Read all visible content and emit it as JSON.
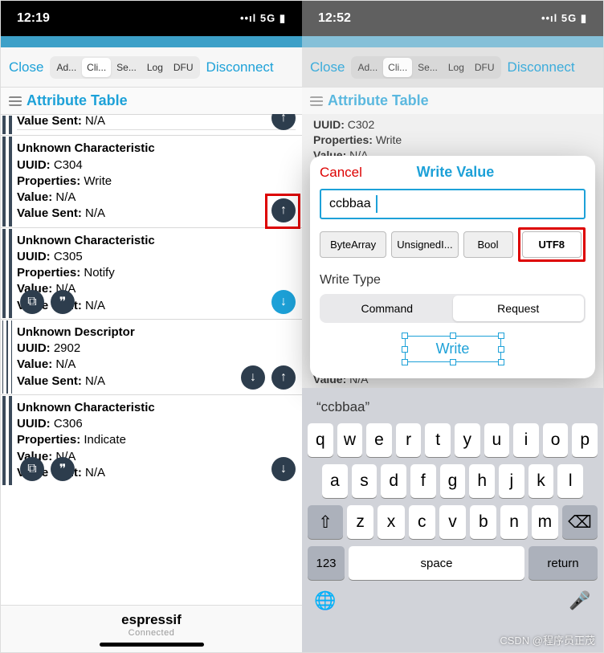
{
  "left": {
    "status": {
      "time": "12:19",
      "signal": "5G"
    },
    "header": {
      "close": "Close",
      "tabs": [
        "Ad...",
        "Cli...",
        "Se...",
        "Log",
        "DFU"
      ],
      "active": 1,
      "disconnect": "Disconnect"
    },
    "title": "Attribute Table",
    "peekRow": {
      "valueSentLbl": "Value Sent:",
      "valueSent": "N/A"
    },
    "chars": [
      {
        "name": "Unknown Characteristic",
        "uuidLbl": "UUID:",
        "uuid": "C304",
        "propsLbl": "Properties:",
        "props": "Write",
        "valueLbl": "Value:",
        "value": "N/A",
        "valueSentLbl": "Value Sent:",
        "valueSent": "N/A",
        "up": true,
        "highlight": true
      },
      {
        "name": "Unknown Characteristic",
        "uuidLbl": "UUID:",
        "uuid": "C305",
        "propsLbl": "Properties:",
        "props": "Notify",
        "valueLbl": "Value:",
        "value": "N/A",
        "valueSentLbl": "Value Sent:",
        "valueSent": "N/A",
        "down": true,
        "copy": true
      },
      {
        "name": "Unknown Descriptor",
        "uuidLbl": "UUID:",
        "uuid": "2902",
        "valueLbl": "Value:",
        "value": "N/A",
        "valueSentLbl": "Value Sent:",
        "valueSent": "N/A",
        "updown": true
      },
      {
        "name": "Unknown Characteristic",
        "uuidLbl": "UUID:",
        "uuid": "C306",
        "propsLbl": "Properties:",
        "props": "Indicate",
        "valueLbl": "Value:",
        "value": "N/A",
        "valueSentLbl": "Value Sent:",
        "valueSent": "N/A",
        "down": true,
        "copy": true
      }
    ],
    "footer": {
      "name": "espressif",
      "status": "Connected"
    }
  },
  "right": {
    "status": {
      "time": "12:52",
      "signal": "5G"
    },
    "header": {
      "close": "Close",
      "tabs": [
        "Ad...",
        "Cli...",
        "Se...",
        "Log",
        "DFU"
      ],
      "active": 1,
      "disconnect": "Disconnect"
    },
    "title": "Attribute Table",
    "bg": {
      "uuidLbl": "UUID:",
      "uuid": "C302",
      "propsLbl": "Properties:",
      "props": "Write",
      "valueLbl": "Value:",
      "value": "N/A",
      "value2Lbl": "Value:",
      "value2": "N/A"
    },
    "modal": {
      "cancel": "Cancel",
      "title": "Write Value",
      "input": "ccbbaa",
      "formats": [
        "ByteArray",
        "UnsignedI...",
        "Bool",
        "UTF8"
      ],
      "active": 3,
      "writeTypeLbl": "Write Type",
      "types": [
        "Command",
        "Request"
      ],
      "typeActive": 1,
      "writeBtn": "Write"
    },
    "keyboard": {
      "suggestion": "“ccbbaa”",
      "row1": [
        "q",
        "w",
        "e",
        "r",
        "t",
        "y",
        "u",
        "i",
        "o",
        "p"
      ],
      "row2": [
        "a",
        "s",
        "d",
        "f",
        "g",
        "h",
        "j",
        "k",
        "l"
      ],
      "row3": [
        "z",
        "x",
        "c",
        "v",
        "b",
        "n",
        "m"
      ],
      "num": "123",
      "space": "space",
      "ret": "return"
    }
  },
  "watermark": "CSDN @程序员正茂"
}
